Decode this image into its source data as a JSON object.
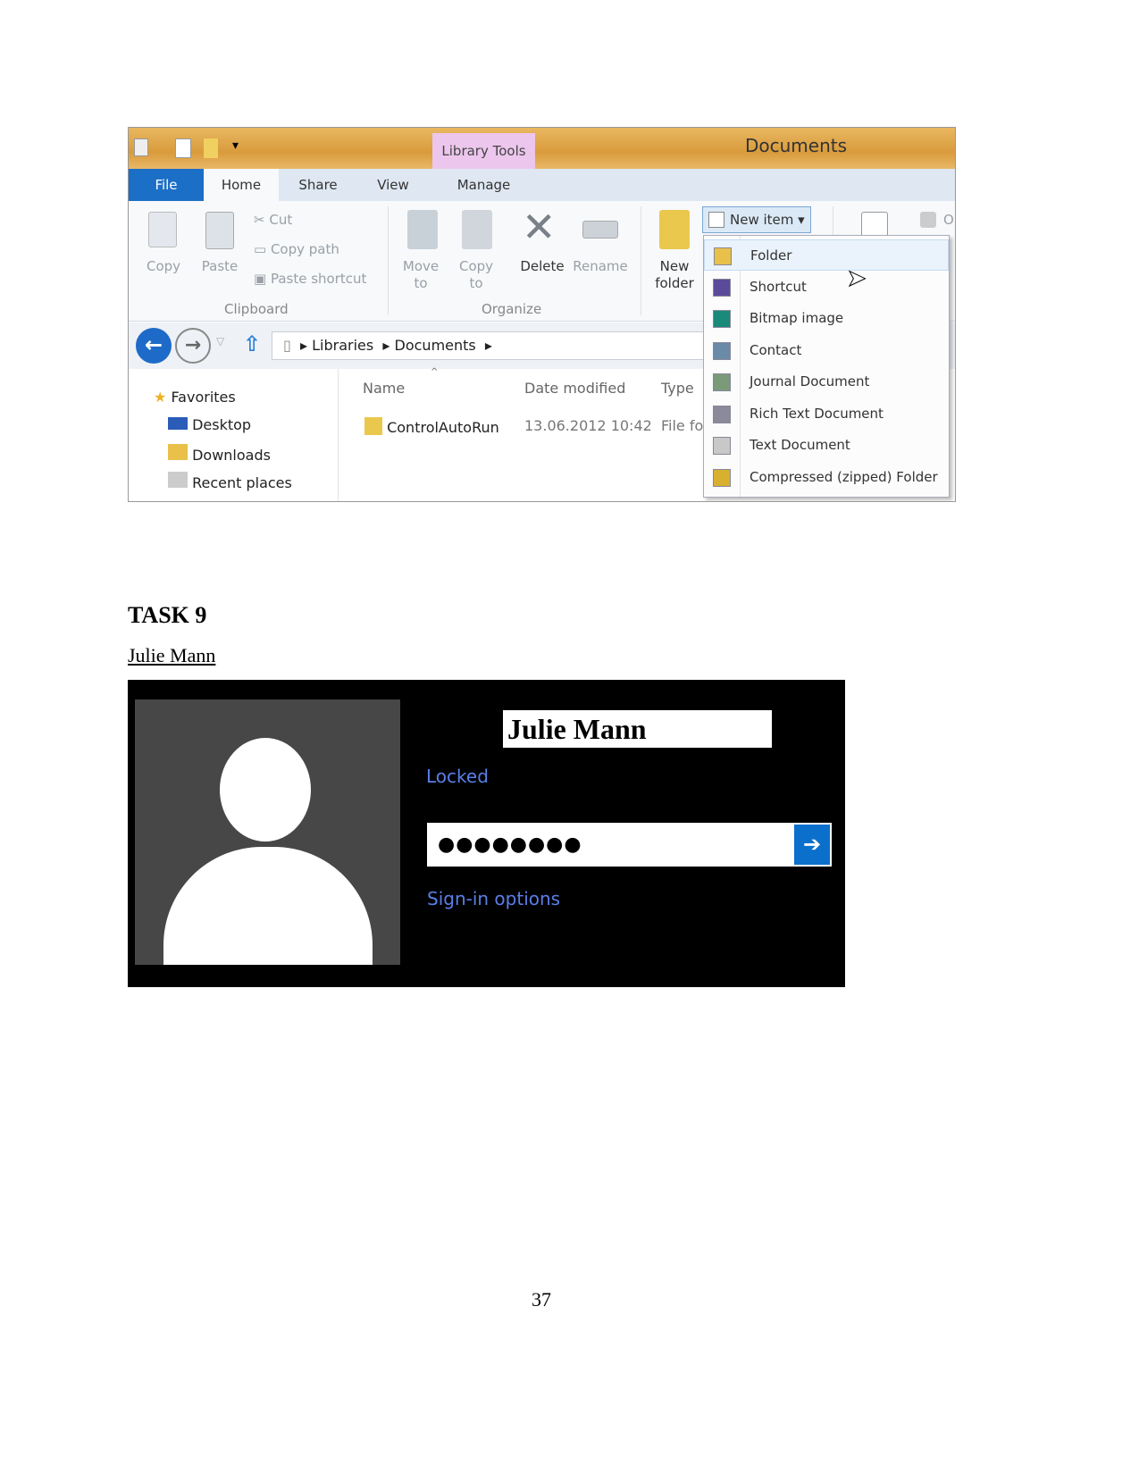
{
  "explorer": {
    "window_title": "Documents",
    "contextual_tab_group": "Library Tools",
    "tabs": [
      "File",
      "Home",
      "Share",
      "View",
      "Manage"
    ],
    "clipboard": {
      "copy": "Copy",
      "paste": "Paste",
      "cut": "Cut",
      "copy_path": "Copy path",
      "paste_shortcut": "Paste shortcut",
      "group_label": "Clipboard"
    },
    "organize": {
      "move_to": "Move to",
      "copy_to": "Copy to",
      "delete": "Delete",
      "rename": "Rename",
      "group_label": "Organize"
    },
    "new": {
      "new_folder": "New folder",
      "new_item": "New item"
    },
    "partial_label": "O",
    "breadcrumb": [
      "Libraries",
      "Documents"
    ],
    "nav_pane": [
      "Favorites",
      "Desktop",
      "Downloads",
      "Recent places"
    ],
    "columns": [
      "Name",
      "Date modified",
      "Type"
    ],
    "files": [
      {
        "name": "ControlAutoRun",
        "date": "13.06.2012 10:42",
        "type": "File fo"
      }
    ],
    "new_item_menu": [
      "Folder",
      "Shortcut",
      "Bitmap image",
      "Contact",
      "Journal Document",
      "Rich Text Document",
      "Text Document",
      "Compressed (zipped) Folder"
    ],
    "menu_icon_colors": [
      "#e8c04a",
      "#5a4a9a",
      "#1a8a7a",
      "#6a8aa8",
      "#7a9a7a",
      "#8a8a9a",
      "#c8c8c8",
      "#d8b030"
    ]
  },
  "task": {
    "heading": "TASK 9",
    "user_link": "Julie Mann"
  },
  "lockscreen": {
    "user_name": "Julie Mann",
    "status": "Locked",
    "password_mask": "●●●●●●●●",
    "submit_icon": "arrow-right-icon",
    "sign_in_options": "Sign-in options",
    "accent": "#0b6fcc"
  },
  "page_number": "37"
}
